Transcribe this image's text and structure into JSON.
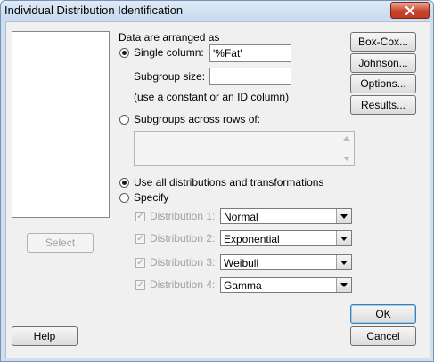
{
  "window": {
    "title": "Individual Distribution Identification"
  },
  "select_button": "Select",
  "help_button": "Help",
  "data_arrangement": {
    "heading": "Data are arranged as",
    "single_column_label": "Single column:",
    "single_column_value": "'%Fat'",
    "subgroup_size_label": "Subgroup size:",
    "subgroup_size_value": "",
    "subgroup_hint": "(use a constant or an ID column)",
    "subgroups_across_rows_label": "Subgroups across rows of:"
  },
  "distribution_mode": {
    "use_all_label": "Use all distributions and transformations",
    "specify_label": "Specify"
  },
  "distributions": [
    {
      "label": "Distribution 1:",
      "value": "Normal"
    },
    {
      "label": "Distribution 2:",
      "value": "Exponential"
    },
    {
      "label": "Distribution 3:",
      "value": "Weibull"
    },
    {
      "label": "Distribution 4:",
      "value": "Gamma"
    }
  ],
  "side_buttons": {
    "box_cox": "Box-Cox...",
    "johnson": "Johnson...",
    "options": "Options...",
    "results": "Results..."
  },
  "ok_button": "OK",
  "cancel_button": "Cancel",
  "colors": {
    "title_close": "#c8442d",
    "dialog_bg": "#f0f0f0"
  },
  "icons": {
    "close": "close-icon",
    "dropdown": "chevron-down-icon"
  }
}
